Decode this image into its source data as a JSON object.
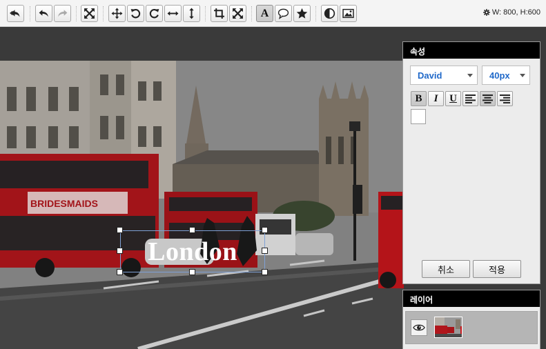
{
  "toolbar": {
    "buttons": [
      {
        "name": "restore-button",
        "icon": "restore-icon"
      },
      {
        "name": "undo-button",
        "icon": "undo-icon"
      },
      {
        "name": "redo-button",
        "icon": "redo-icon",
        "state": "disabled"
      },
      {
        "name": "fit-screen-button",
        "icon": "expand-arrows-icon"
      },
      {
        "name": "move-button",
        "icon": "move-icon"
      },
      {
        "name": "rotate-left-button",
        "icon": "rotate-left-icon"
      },
      {
        "name": "rotate-right-button",
        "icon": "rotate-right-icon"
      },
      {
        "name": "flip-horizontal-button",
        "icon": "flip-horizontal-icon"
      },
      {
        "name": "flip-vertical-button",
        "icon": "flip-vertical-icon"
      },
      {
        "name": "crop-button",
        "icon": "crop-icon"
      },
      {
        "name": "resize-button",
        "icon": "resize-icon"
      },
      {
        "name": "text-tool-button",
        "icon": "text-icon",
        "label": "A",
        "state": "active"
      },
      {
        "name": "speech-bubble-button",
        "icon": "speech-bubble-icon"
      },
      {
        "name": "sticker-button",
        "icon": "star-icon"
      },
      {
        "name": "filter-button",
        "icon": "contrast-icon"
      },
      {
        "name": "image-button",
        "icon": "image-icon"
      }
    ],
    "size_readout": "W: 800, H:600",
    "size_icon": "gear-icon"
  },
  "canvas": {
    "text_layer": "London",
    "photo": "London street with red double-decker buses and Parliament tower"
  },
  "properties": {
    "title": "속성",
    "font_family": "David",
    "font_size": "40px",
    "format_buttons": [
      {
        "name": "bold-button",
        "label": "B",
        "state": "active"
      },
      {
        "name": "italic-button",
        "label": "I"
      },
      {
        "name": "underline-button",
        "label": "U"
      },
      {
        "name": "align-left-button",
        "icon": "align-left-icon"
      },
      {
        "name": "align-center-button",
        "icon": "align-center-icon",
        "state": "active"
      },
      {
        "name": "align-right-button",
        "icon": "align-right-icon"
      }
    ],
    "text_color": "#ffffff",
    "cancel_label": "취소",
    "apply_label": "적용"
  },
  "layers": {
    "title": "레이어",
    "items": [
      {
        "visible": true,
        "icon": "eye-icon",
        "thumbnail": "photo-thumbnail"
      }
    ]
  }
}
